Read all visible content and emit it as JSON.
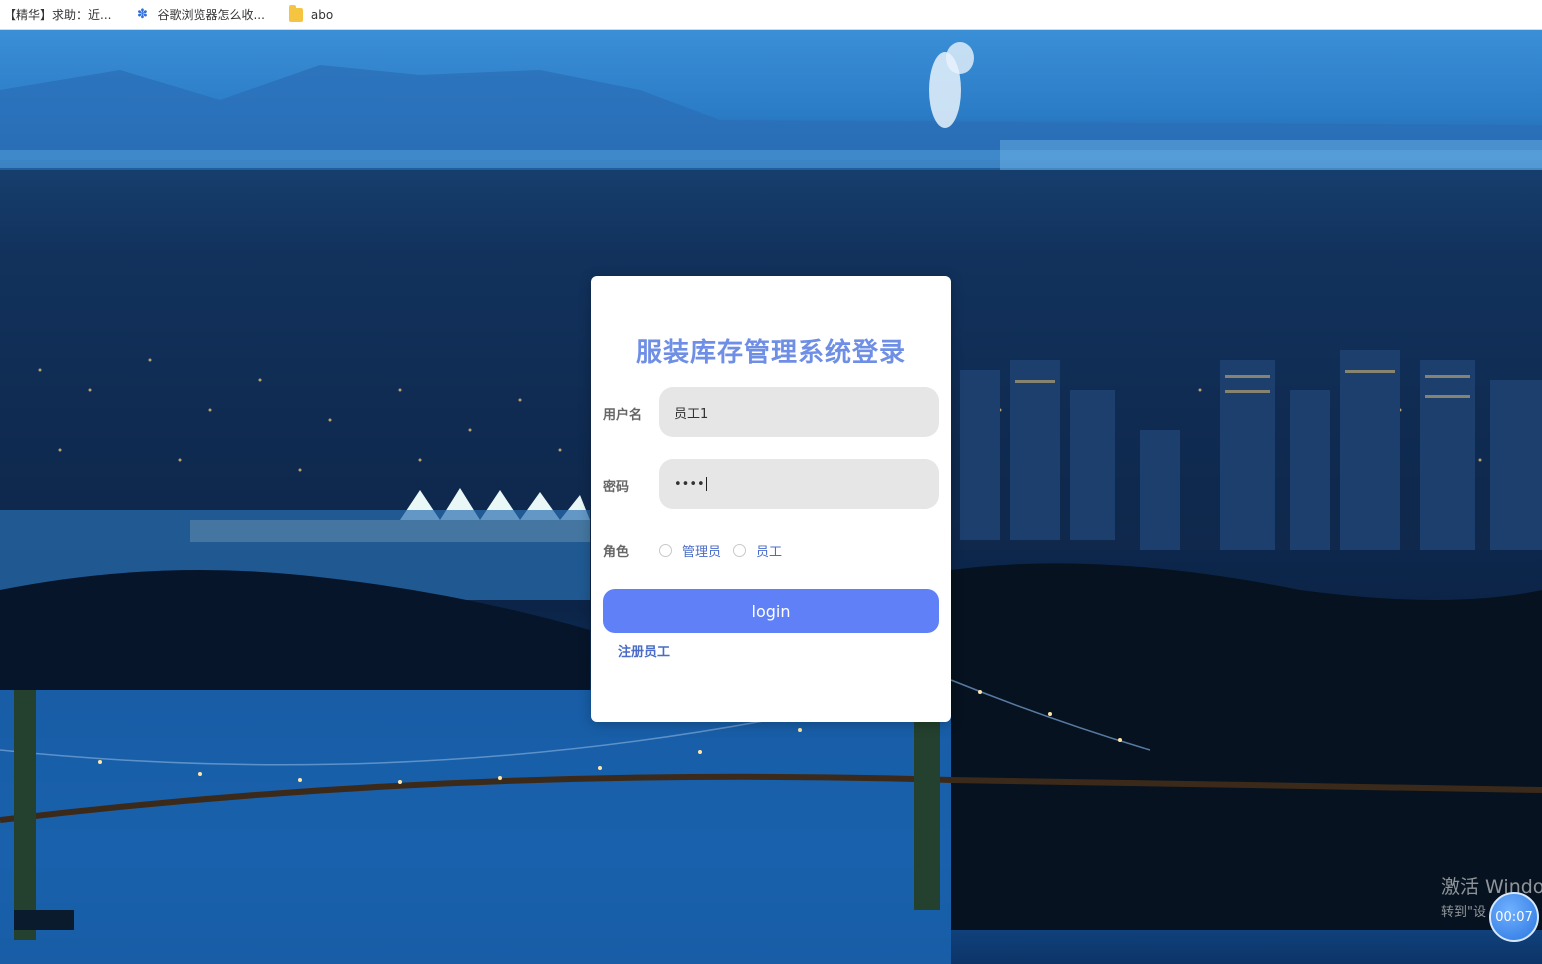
{
  "bookmarks": [
    {
      "label": "【精华】求助：近...",
      "icon": "none"
    },
    {
      "label": "谷歌浏览器怎么收...",
      "icon": "paw-icon"
    },
    {
      "label": "abo",
      "icon": "folder-icon"
    }
  ],
  "login": {
    "title": "服装库存管理系统登录",
    "username_label": "用户名",
    "username_value": "员工1",
    "password_label": "密码",
    "password_value": "••••",
    "role_label": "角色",
    "role_options": [
      "管理员",
      "员工"
    ],
    "login_button": "login",
    "register_link": "注册员工"
  },
  "overlay": {
    "watermark_line1": "激活 Windo",
    "watermark_line2": "转到\"设",
    "timer": "00:07"
  },
  "colors": {
    "accent": "#5f80f7",
    "title": "#6f8fe6",
    "link": "#4a6cc8"
  }
}
